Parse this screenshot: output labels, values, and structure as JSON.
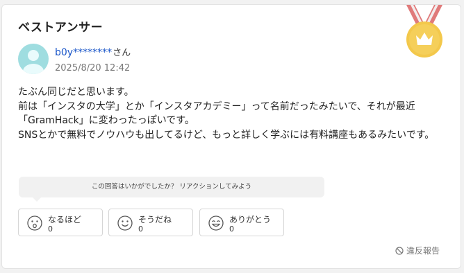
{
  "header": {
    "title": "ベストアンサー"
  },
  "medal": {
    "icon": "crown-medal-icon",
    "ribbon_color": "#e07a7a",
    "coin_color": "#f3c84b"
  },
  "author": {
    "name": "b0y********",
    "suffix": "さん",
    "date": "2025/8/20 12:42",
    "avatar_color": "#9fdde0"
  },
  "answer": {
    "lines": [
      "たぶん同じだと思います。",
      "前は「インスタの大学」とか「インスタアカデミー」って名前だったみたいで、それが最近「GramHack」に変わったっぽいです。",
      "SNSとかで無料でノウハウも出してるけど、もっと詳しく学ぶには有料講座もあるみたいです。"
    ]
  },
  "reactions": {
    "prompt": "この回答はいかがでしたか？ リアクションしてみよう",
    "items": [
      {
        "label": "なるほど",
        "count": "0",
        "icon": "surprised-face-icon"
      },
      {
        "label": "そうだね",
        "count": "0",
        "icon": "smile-face-icon"
      },
      {
        "label": "ありがとう",
        "count": "0",
        "icon": "grin-face-icon"
      }
    ]
  },
  "report": {
    "label": "違反報告",
    "icon": "prohibited-icon"
  }
}
